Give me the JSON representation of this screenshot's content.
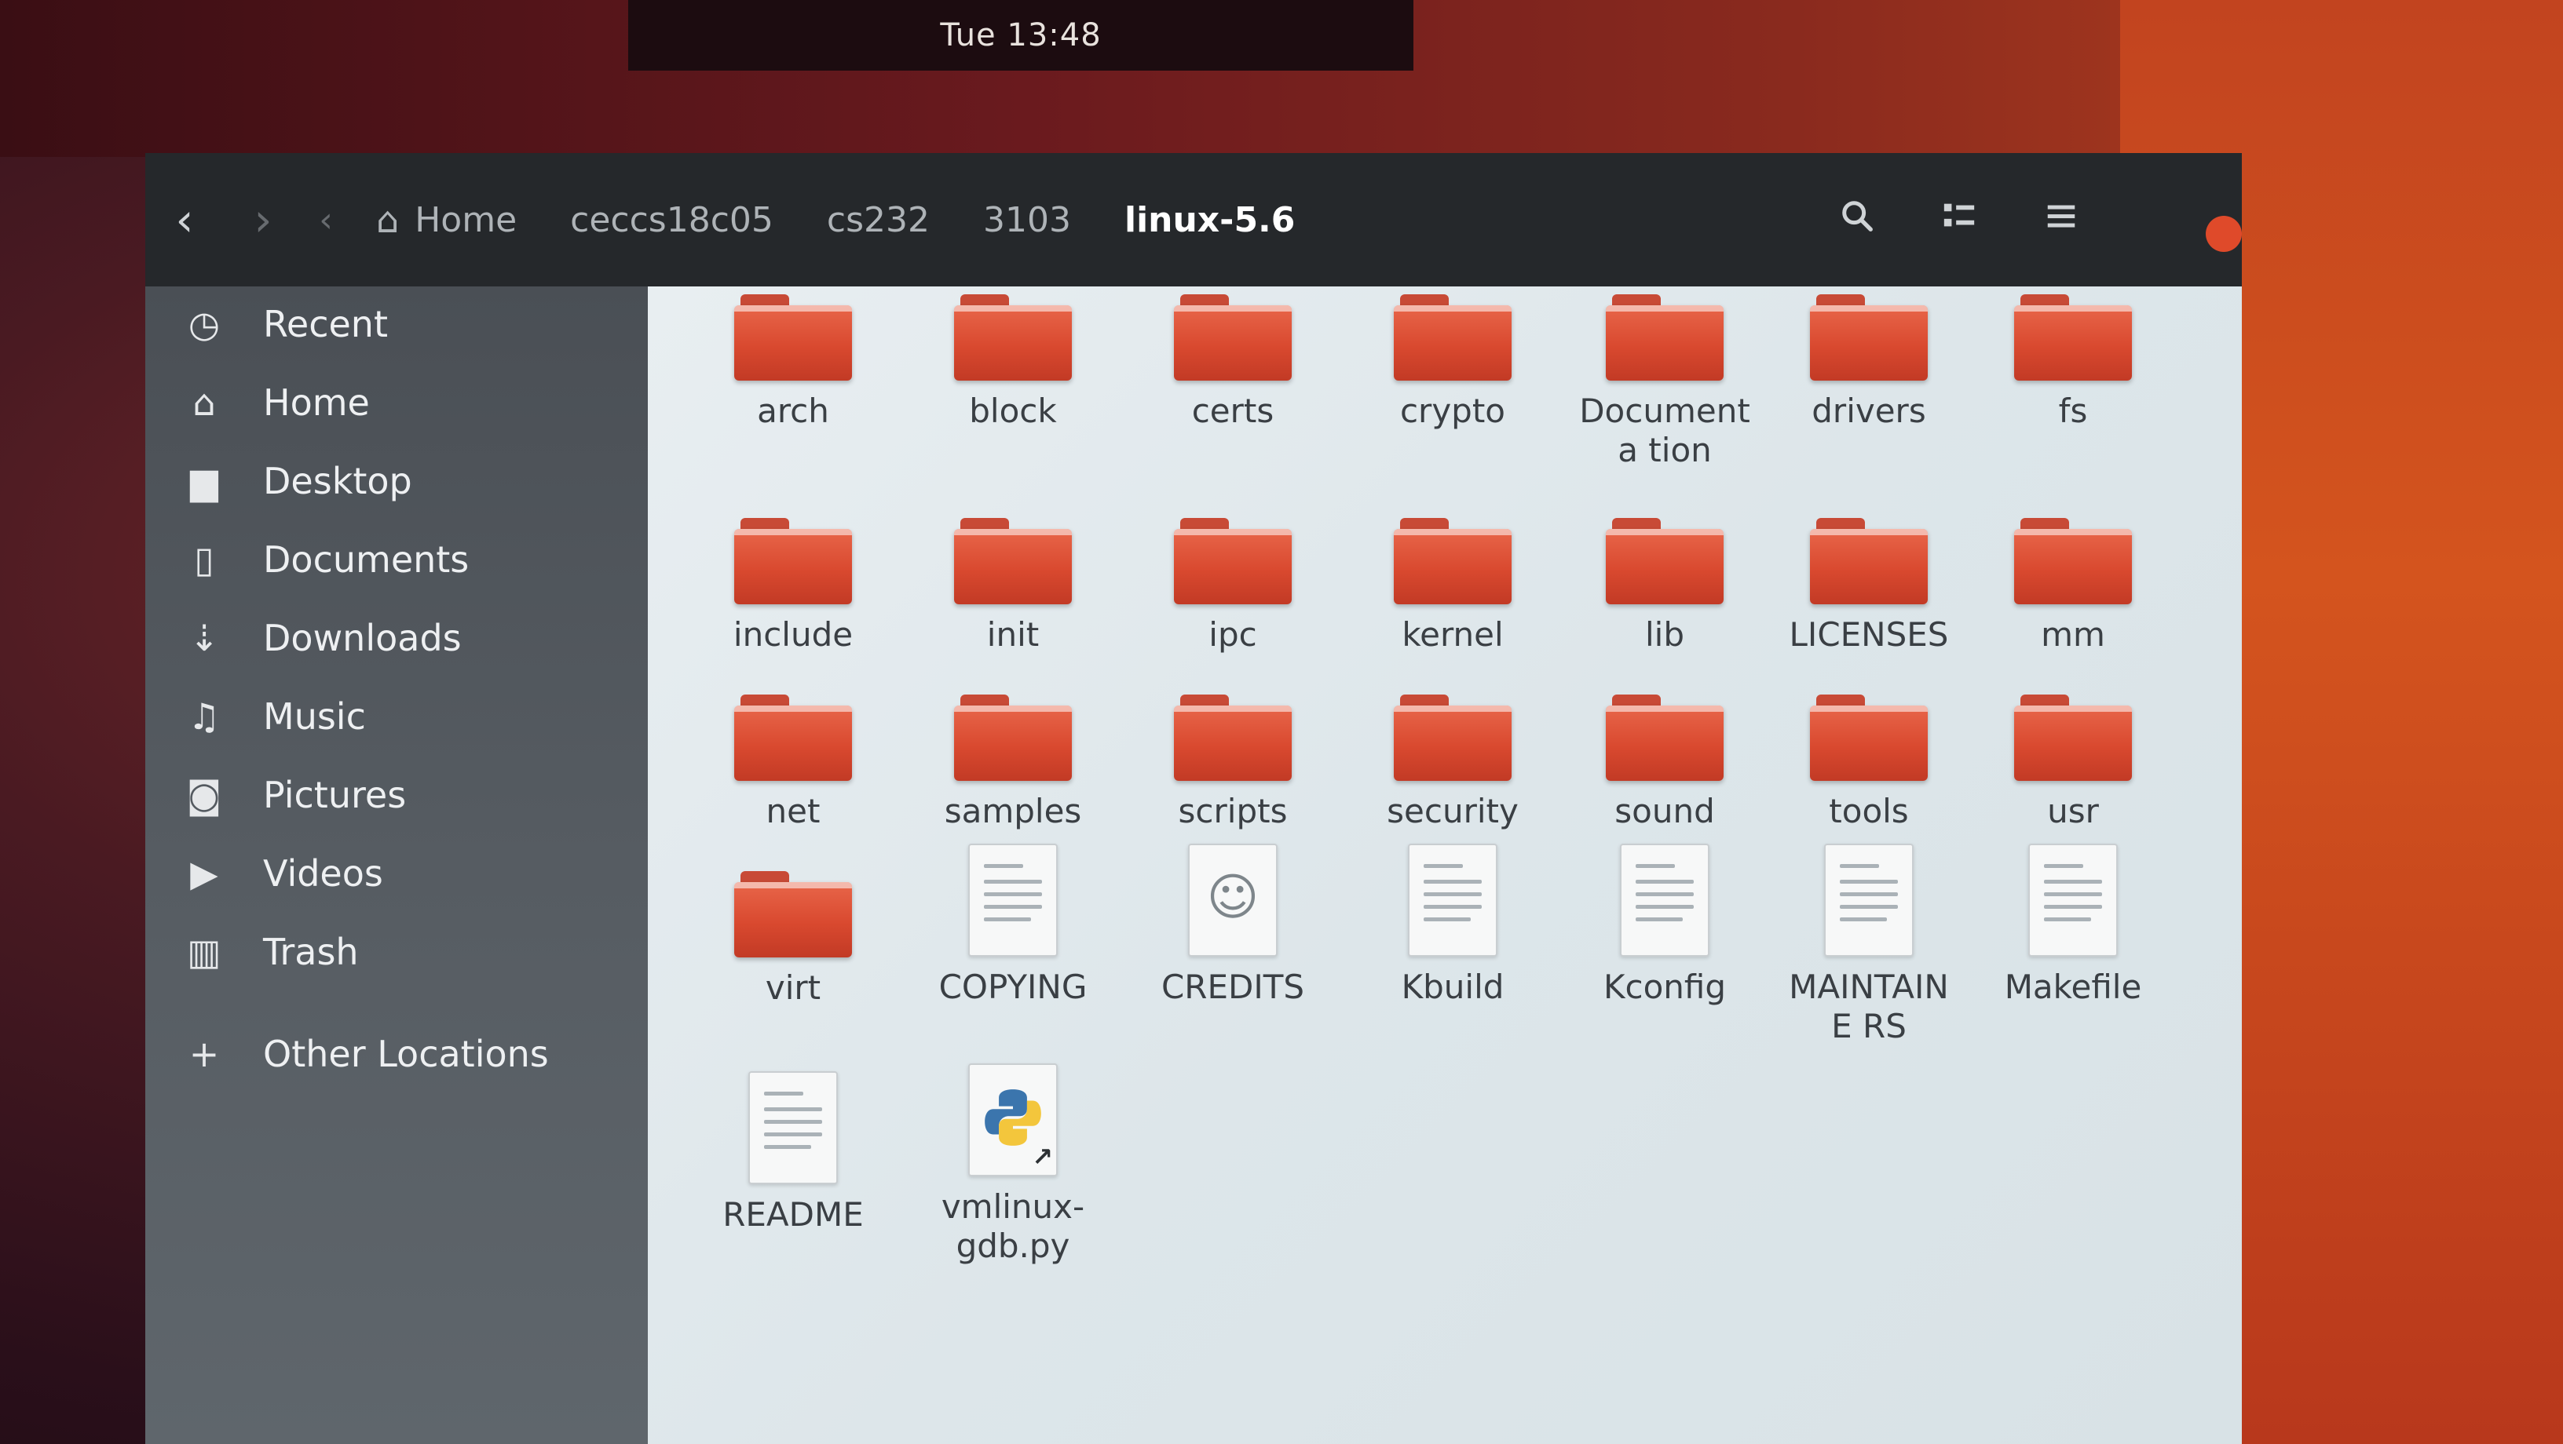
{
  "topbar": {
    "clock": "Tue 13:48"
  },
  "header": {
    "breadcrumbs": [
      {
        "label": "Home",
        "icon": "home-icon"
      },
      {
        "label": "ceccs18c05"
      },
      {
        "label": "cs232"
      },
      {
        "label": "3103"
      },
      {
        "label": "linux-5.6"
      }
    ],
    "icons": {
      "back": "chevron-left-icon",
      "forward": "chevron-right-icon",
      "search": "search-icon",
      "view": "view-list-icon",
      "menu": "hamburger-menu-icon"
    }
  },
  "sidebar": {
    "items": [
      {
        "label": "Recent",
        "icon": "clock-icon"
      },
      {
        "label": "Home",
        "icon": "home-icon"
      },
      {
        "label": "Desktop",
        "icon": "desktop-folder-icon"
      },
      {
        "label": "Documents",
        "icon": "document-icon"
      },
      {
        "label": "Downloads",
        "icon": "download-icon"
      },
      {
        "label": "Music",
        "icon": "music-icon"
      },
      {
        "label": "Pictures",
        "icon": "camera-icon"
      },
      {
        "label": "Videos",
        "icon": "video-icon"
      },
      {
        "label": "Trash",
        "icon": "trash-icon"
      },
      {
        "label": "Other Locations",
        "icon": "plus-icon"
      }
    ]
  },
  "files": [
    {
      "name": "arch",
      "kind": "folder"
    },
    {
      "name": "block",
      "kind": "folder"
    },
    {
      "name": "certs",
      "kind": "folder"
    },
    {
      "name": "crypto",
      "kind": "folder"
    },
    {
      "name": "Documenta tion",
      "kind": "folder"
    },
    {
      "name": "drivers",
      "kind": "folder"
    },
    {
      "name": "fs",
      "kind": "folder"
    },
    {
      "name": "include",
      "kind": "folder"
    },
    {
      "name": "init",
      "kind": "folder"
    },
    {
      "name": "ipc",
      "kind": "folder"
    },
    {
      "name": "kernel",
      "kind": "folder"
    },
    {
      "name": "lib",
      "kind": "folder"
    },
    {
      "name": "LICENSES",
      "kind": "folder"
    },
    {
      "name": "mm",
      "kind": "folder"
    },
    {
      "name": "net",
      "kind": "folder"
    },
    {
      "name": "samples",
      "kind": "folder"
    },
    {
      "name": "scripts",
      "kind": "folder"
    },
    {
      "name": "security",
      "kind": "folder"
    },
    {
      "name": "sound",
      "kind": "folder"
    },
    {
      "name": "tools",
      "kind": "folder"
    },
    {
      "name": "usr",
      "kind": "folder"
    },
    {
      "name": "virt",
      "kind": "folder"
    },
    {
      "name": "COPYING",
      "kind": "text"
    },
    {
      "name": "CREDITS",
      "kind": "contact"
    },
    {
      "name": "Kbuild",
      "kind": "text"
    },
    {
      "name": "Kconfig",
      "kind": "text"
    },
    {
      "name": "MAINTAINE RS",
      "kind": "text"
    },
    {
      "name": "Makefile",
      "kind": "text"
    },
    {
      "name": "README",
      "kind": "text"
    },
    {
      "name": "vmlinux- gdb.py",
      "kind": "python-link"
    }
  ]
}
